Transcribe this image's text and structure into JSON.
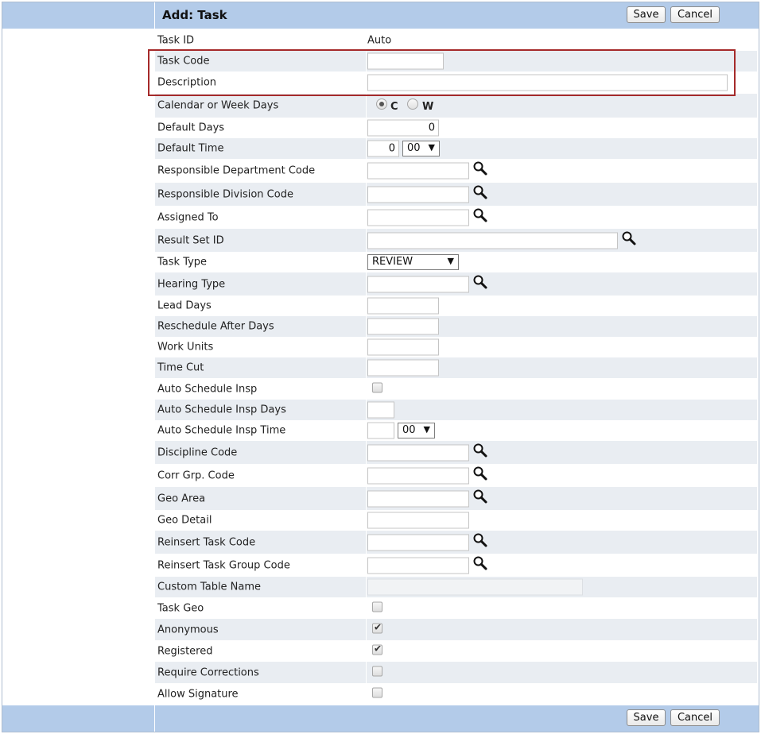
{
  "header": {
    "title": "Add: Task",
    "save_label": "Save",
    "cancel_label": "Cancel"
  },
  "footer": {
    "save_label": "Save",
    "cancel_label": "Cancel"
  },
  "fields": {
    "task_id": {
      "label": "Task ID",
      "value": "Auto"
    },
    "task_code": {
      "label": "Task Code",
      "value": ""
    },
    "description": {
      "label": "Description",
      "value": ""
    },
    "calendar_week": {
      "label": "Calendar or Week Days",
      "option_c": "C",
      "option_w": "W",
      "selected": "C"
    },
    "default_days": {
      "label": "Default Days",
      "value": "0"
    },
    "default_time": {
      "label": "Default Time",
      "hours": "0",
      "minutes": "00"
    },
    "resp_dept": {
      "label": "Responsible Department Code",
      "value": ""
    },
    "resp_div": {
      "label": "Responsible Division Code",
      "value": ""
    },
    "assigned_to": {
      "label": "Assigned To",
      "value": ""
    },
    "result_set": {
      "label": "Result Set ID",
      "value": ""
    },
    "task_type": {
      "label": "Task Type",
      "value": "REVIEW"
    },
    "hearing_type": {
      "label": "Hearing Type",
      "value": ""
    },
    "lead_days": {
      "label": "Lead Days",
      "value": ""
    },
    "reschedule": {
      "label": "Reschedule After Days",
      "value": ""
    },
    "work_units": {
      "label": "Work Units",
      "value": ""
    },
    "time_cut": {
      "label": "Time Cut",
      "value": ""
    },
    "auto_sched": {
      "label": "Auto Schedule Insp",
      "checked": false
    },
    "auto_sched_days": {
      "label": "Auto Schedule Insp Days",
      "value": ""
    },
    "auto_sched_time": {
      "label": "Auto Schedule Insp Time",
      "hours": "",
      "minutes": "00"
    },
    "discipline": {
      "label": "Discipline Code",
      "value": ""
    },
    "corr_grp": {
      "label": "Corr Grp. Code",
      "value": ""
    },
    "geo_area": {
      "label": "Geo Area",
      "value": ""
    },
    "geo_detail": {
      "label": "Geo Detail",
      "value": ""
    },
    "reinsert_task": {
      "label": "Reinsert Task Code",
      "value": ""
    },
    "reinsert_group": {
      "label": "Reinsert Task Group Code",
      "value": ""
    },
    "custom_table": {
      "label": "Custom Table Name",
      "value": ""
    },
    "task_geo": {
      "label": "Task Geo",
      "checked": false
    },
    "anonymous": {
      "label": "Anonymous",
      "checked": true
    },
    "registered": {
      "label": "Registered",
      "checked": true
    },
    "require_corr": {
      "label": "Require Corrections",
      "checked": false
    },
    "allow_sig": {
      "label": "Allow Signature",
      "checked": false
    }
  },
  "icons": {
    "lookup": "magnifier-icon",
    "dropdown": "chevron-down-icon",
    "check": "checkmark-icon"
  },
  "colors": {
    "header_bar": "#b3cbe9",
    "alt_row": "#e9edf2",
    "highlight_border": "#a52a2a"
  }
}
